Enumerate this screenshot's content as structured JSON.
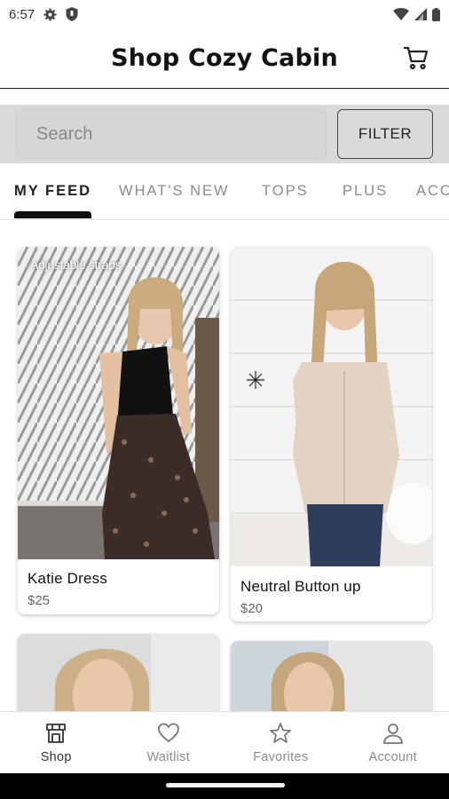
{
  "status_bar": {
    "time": "6:57"
  },
  "header": {
    "title": "Shop Cozy Cabin"
  },
  "search": {
    "placeholder": "Search",
    "filter_label": "FILTER"
  },
  "tabs": [
    {
      "label": "MY FEED",
      "active": true
    },
    {
      "label": "WHAT'S NEW",
      "active": false
    },
    {
      "label": "TOPS",
      "active": false
    },
    {
      "label": "PLUS",
      "active": false
    },
    {
      "label": "ACC",
      "active": false
    }
  ],
  "products": [
    {
      "name": "Katie Dress",
      "price": "$25",
      "image_caption": "Adjustable straps"
    },
    {
      "name": "Neutral Button up",
      "price": "$20"
    }
  ],
  "bottom_nav": [
    {
      "label": "Shop",
      "icon": "shop-icon",
      "active": true
    },
    {
      "label": "Waitlist",
      "icon": "heart-icon",
      "active": false
    },
    {
      "label": "Favorites",
      "icon": "star-icon",
      "active": false
    },
    {
      "label": "Account",
      "icon": "person-icon",
      "active": false
    }
  ],
  "colors": {
    "accent": "#111111",
    "search_strip": "#d9d9d9",
    "inactive_text": "#8a8a8a"
  }
}
